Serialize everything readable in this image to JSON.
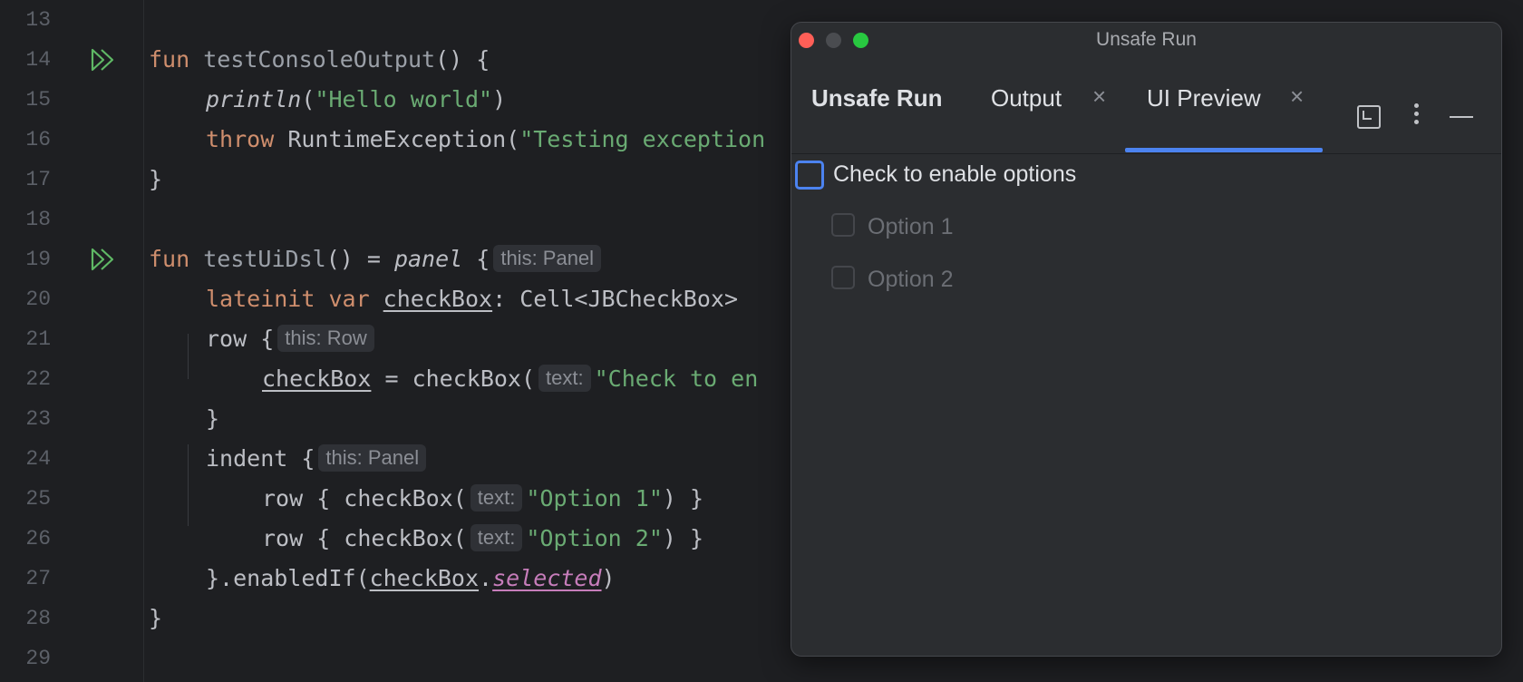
{
  "editor": {
    "line_numbers": [
      "13",
      "14",
      "15",
      "16",
      "17",
      "18",
      "19",
      "20",
      "21",
      "22",
      "23",
      "24",
      "25",
      "26",
      "27",
      "28",
      "29"
    ],
    "tokens": {
      "fun": "fun",
      "testConsoleOutput": "testConsoleOutput",
      "parens_brace": "() {",
      "println": "println",
      "open_paren": "(",
      "hello_str": "\"Hello world\"",
      "close_paren": ")",
      "throw": "throw",
      "runtime_exc": "RuntimeException(",
      "testing_str": "\"Testing exception",
      "close_brace": "}",
      "testUiDsl": "testUiDsl",
      "eq_panel_pre": "() = ",
      "panel": "panel",
      "open_brace": " {",
      "lateinit_var": "lateinit var ",
      "checkBox": "checkBox",
      "cell_type": ": Cell<JBCheckBox>",
      "row_brace": "row {",
      "assign_checkbox": " = checkBox(",
      "check_str": "\"Check to en",
      "indent_brace": "indent {",
      "row_checkbox": "row { checkBox(",
      "option1_str": "\"Option 1\"",
      "option2_str": "\"Option 2\"",
      "close_paren_brace": ") }",
      "enabled_if": "}.enabledIf(",
      "dot": ".",
      "selected": "selected"
    },
    "hints": {
      "this_panel": "this: Panel",
      "this_row": "this: Row",
      "text": "text:"
    },
    "colors": {
      "background": "#1e1f22",
      "keyword": "#cf8e6d",
      "string": "#6aab73",
      "property": "#c77dbb",
      "run_icon": "#5fb865"
    }
  },
  "toolwindow": {
    "window_title": "Unsafe Run",
    "name": "Unsafe Run",
    "tabs": [
      {
        "label": "Output",
        "close": "×"
      },
      {
        "label": "UI Preview",
        "close": "×",
        "selected": true
      }
    ],
    "accent": "#4c83f0",
    "icons": [
      "restore-icon",
      "more-vertical-icon",
      "minimize-icon"
    ]
  },
  "preview": {
    "main_checkbox": {
      "label": "Check to enable options",
      "checked": false
    },
    "options": [
      {
        "label": "Option 1",
        "enabled": false
      },
      {
        "label": "Option 2",
        "enabled": false
      }
    ]
  }
}
